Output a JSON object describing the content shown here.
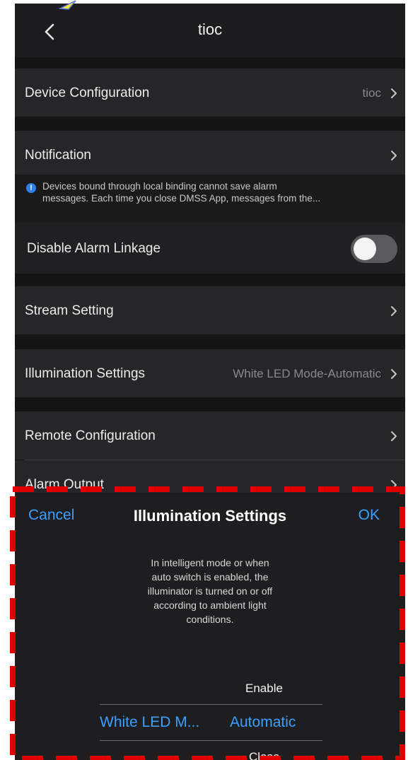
{
  "nav": {
    "title": "tioc",
    "back_icon": "chevron-left-icon"
  },
  "settings": {
    "device_configuration": {
      "label": "Device Configuration",
      "value": "tioc"
    },
    "notification": {
      "label": "Notification",
      "note": [
        "Devices bound through local binding cannot save alarm",
        "messages. Each time you close DMSS App, messages from the..."
      ]
    },
    "disable_alarm_linkage": {
      "label": "Disable Alarm Linkage",
      "enabled": false
    },
    "stream_setting": {
      "label": "Stream Setting"
    },
    "illumination_settings": {
      "label": "Illumination Settings",
      "value": "White LED Mode-Automatic"
    },
    "remote_configuration": {
      "label": "Remote Configuration"
    },
    "alarm_output": {
      "label": "Alarm Output"
    }
  },
  "sheet": {
    "cancel_label": "Cancel",
    "title": "Illumination Settings",
    "ok_label": "OK",
    "description": [
      "In intelligent mode or when",
      "auto switch is enabled, the",
      "illuminator is turned on or off",
      "according to ambient light",
      "conditions."
    ],
    "picker": {
      "above_option": "Enable",
      "selected_left": "White LED M...",
      "selected_right": "Automatic",
      "below_option": "Close"
    }
  },
  "colors": {
    "accent": "#3a9fff",
    "background": "#141414",
    "row_background": "#262628",
    "info_icon": "#2f80ed",
    "highlight": "#e00000"
  }
}
